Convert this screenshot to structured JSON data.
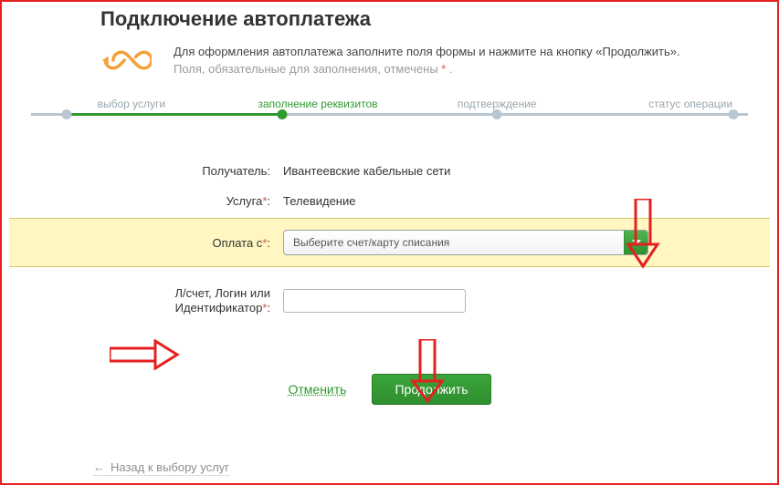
{
  "title": "Подключение автоплатежа",
  "intro": {
    "line1": "Для оформления автоплатежа заполните поля формы и нажмите на кнопку «Продолжить».",
    "line2": "Поля, обязательные для заполнения, отмечены ",
    "asterisk": "*",
    "tail": " ."
  },
  "steps": {
    "s1": "выбор услуги",
    "s2": "заполнение реквизитов",
    "s3": "подтверждение",
    "s4": "статус операции"
  },
  "form": {
    "recipient_label": "Получатель:",
    "recipient_value": "Ивантеевские кабельные сети",
    "service_label": "Услуга",
    "service_value": "Телевидение",
    "payfrom_label": "Оплата с",
    "payfrom_placeholder": "Выберите счет/карту списания",
    "ident_label_l1": "Л/счет, Логин или",
    "ident_label_l2": "Идентификатор",
    "required_mark": "*",
    "colon": ":"
  },
  "actions": {
    "cancel": "Отменить",
    "continue": "Продолжить"
  },
  "back": "Назад к выбору услуг"
}
